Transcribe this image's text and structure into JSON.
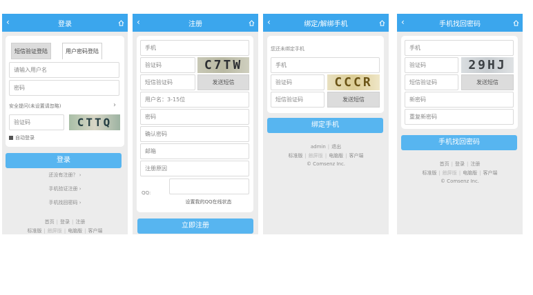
{
  "p1": {
    "title": "登录",
    "tab_sms": "短信验证登陆",
    "tab_pw": "用户密码登陆",
    "username_ph": "请输入用户名",
    "password_ph": "密码",
    "question": "安全提问(未设置请忽略)",
    "captcha_ph": "验证码",
    "captcha_img": "CTTQ",
    "auto_login": "自动登录",
    "login_btn": "登录",
    "no_account": "还没有注册？",
    "phone_register": "手机验证注册",
    "phone_find_pw": "手机找回密码",
    "foot_home": "首页",
    "foot_login": "登录",
    "foot_register": "注册",
    "foot_standard": "标准版",
    "foot_touch": "触屏版",
    "foot_pc": "电脑版",
    "foot_client": "客户端"
  },
  "p2": {
    "title": "注册",
    "phone_ph": "手机",
    "captcha_ph": "验证码",
    "captcha_img": "C7TW",
    "sms_ph": "短信验证码",
    "send_sms": "发送短信",
    "username_ph": "用户名：3-15位",
    "password_ph": "密码",
    "confirm_ph": "确认密码",
    "email_ph": "邮箱",
    "reason_ph": "注册原因",
    "qq_label": "QQ:",
    "qq_hint": "设置我的QQ在线状态",
    "submit": "立即注册"
  },
  "p3": {
    "title": "绑定/解绑手机",
    "notice": "您还未绑定手机",
    "phone_ph": "手机",
    "captcha_ph": "验证码",
    "captcha_img": "CCCR",
    "sms_ph": "短信验证码",
    "send_sms": "发送短信",
    "bind_btn": "绑定手机",
    "user": "admin",
    "logout": "退出",
    "foot_standard": "标准版",
    "foot_touch": "触屏版",
    "foot_pc": "电脑版",
    "foot_client": "客户端",
    "copyright": "© Comsenz Inc."
  },
  "p4": {
    "title": "手机找回密码",
    "phone_ph": "手机",
    "captcha_ph": "验证码",
    "captcha_img": "29HJ",
    "sms_ph": "短信验证码",
    "send_sms": "发送短信",
    "new_pw_ph": "新密码",
    "repeat_pw_ph": "重复新密码",
    "find_btn": "手机找回密码",
    "foot_home": "首页",
    "foot_login": "登录",
    "foot_register": "注册",
    "foot_standard": "标准版",
    "foot_touch": "触屏版",
    "foot_pc": "电脑版",
    "foot_client": "客户端",
    "copyright": "© Comsenz Inc."
  },
  "colors": {
    "header": "#3ba6ed",
    "button": "#57b5f0",
    "background": "#ececec"
  },
  "icons": {
    "back": "chevron-left-icon",
    "home": "home-icon"
  }
}
